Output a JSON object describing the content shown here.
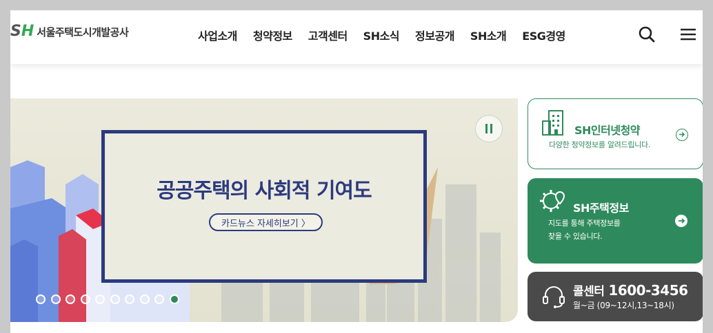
{
  "logo": {
    "mark_s": "S",
    "mark_h": "H",
    "name": "서울주택도시개발공사"
  },
  "nav": {
    "items": [
      {
        "label": "사업소개"
      },
      {
        "label": "청약정보"
      },
      {
        "label": "고객센터"
      },
      {
        "label": "SH소식"
      },
      {
        "label": "정보공개"
      },
      {
        "label": "SH소개"
      },
      {
        "label": "ESG경영"
      }
    ],
    "search_icon": "search-icon",
    "menu_icon": "hamburger-menu-icon"
  },
  "banner": {
    "title": "공공주택의 사회적 기여도",
    "button_label": "카드뉴스 자세히보기 〉",
    "pause_icon": "pause-icon",
    "slide_count": 10,
    "active_slide": 10
  },
  "side": {
    "subscription": {
      "title": "SH인터넷청약",
      "desc": "다양한 청약정보를 알려드립니다.",
      "icon": "building-icon"
    },
    "housing": {
      "title": "SH주택정보",
      "desc_line1": "지도를 통해 주택정보를",
      "desc_line2": "찾을 수 있습니다.",
      "icon": "gear-location-icon"
    },
    "callcenter": {
      "title": "콜센터",
      "phone": "1600-3456",
      "hours": "월~금 (09~12시,13~18시)",
      "icon": "headset-icon"
    }
  },
  "colors": {
    "brand_green": "#2e8a5c",
    "navy": "#2b3a7e",
    "dark_card": "#4a4a4a"
  }
}
